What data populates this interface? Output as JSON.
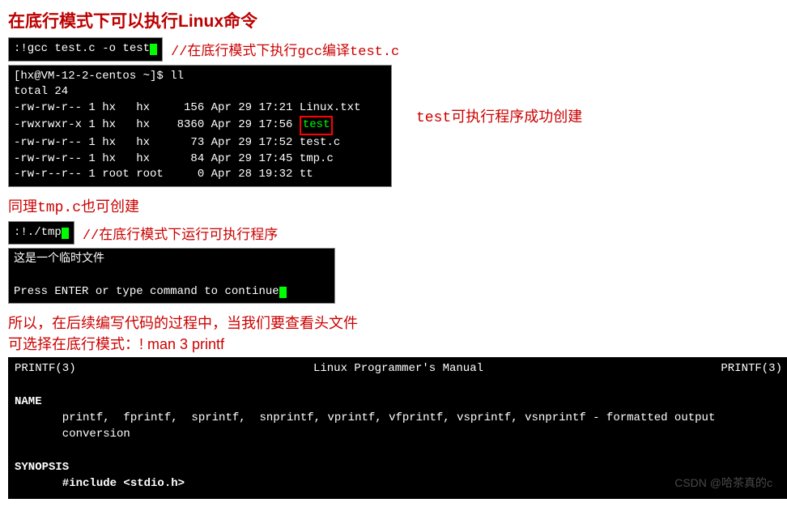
{
  "title": "在底行模式下可以执行Linux命令",
  "cmd1": {
    "text": ":!gcc test.c -o test",
    "comment": "//在底行模式下执行gcc编译test.c"
  },
  "ll_output": {
    "prompt": "[hx@VM-12-2-centos ~]$ ll",
    "total": "total 24",
    "rows": [
      {
        "perm": "-rw-rw-r--",
        "n": "1",
        "u": "hx  ",
        "g": "hx  ",
        "size": "  156",
        "date": "Apr 29 17:21",
        "name": "Linux.txt",
        "hl": false
      },
      {
        "perm": "-rwxrwxr-x",
        "n": "1",
        "u": "hx  ",
        "g": "hx  ",
        "size": " 8360",
        "date": "Apr 29 17:56",
        "name": "test",
        "hl": true
      },
      {
        "perm": "-rw-rw-r--",
        "n": "1",
        "u": "hx  ",
        "g": "hx  ",
        "size": "   73",
        "date": "Apr 29 17:52",
        "name": "test.c",
        "hl": false
      },
      {
        "perm": "-rw-rw-r--",
        "n": "1",
        "u": "hx  ",
        "g": "hx  ",
        "size": "   84",
        "date": "Apr 29 17:45",
        "name": "tmp.c",
        "hl": false
      },
      {
        "perm": "-rw-r--r--",
        "n": "1",
        "u": "root",
        "g": "root",
        "size": "    0",
        "date": "Apr 28 19:32",
        "name": "tt",
        "hl": false
      }
    ],
    "side_note": "test可执行程序成功创建"
  },
  "tmp_note": "同理tmp.c也可创建",
  "cmd2": {
    "text": ":!./tmp",
    "comment": "//在底行模式下运行可执行程序"
  },
  "tmp_output": {
    "line1": "这是一个临时文件",
    "line2": "Press ENTER or type command to continue"
  },
  "conclusion": {
    "line1": "所以，在后续编写代码的过程中，当我们要查看头文件",
    "line2": "可选择在底行模式：! man 3 printf"
  },
  "man": {
    "left": "PRINTF(3)",
    "center": "Linux Programmer's Manual",
    "right": "PRINTF(3)",
    "name_hdr": "NAME",
    "name_body": "       printf,  fprintf,  sprintf,  snprintf, vprintf, vfprintf, vsprintf, vsnprintf - formatted output\n       conversion",
    "syn_hdr": "SYNOPSIS",
    "syn_body": "       #include <stdio.h>"
  },
  "watermark": "CSDN @哈茶真的c"
}
